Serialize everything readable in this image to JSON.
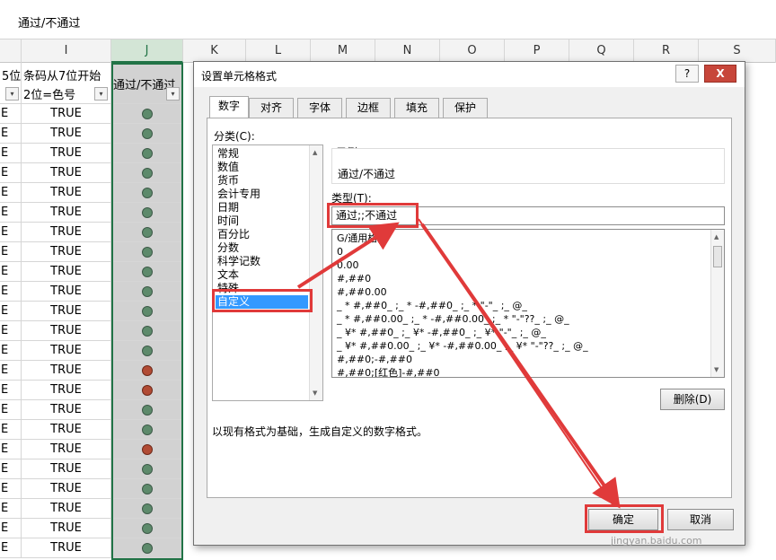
{
  "formula_bar": {
    "value": "通过/不通过"
  },
  "columns": [
    "I",
    "J",
    "K",
    "L",
    "M",
    "N",
    "O",
    "P",
    "Q",
    "R",
    "S"
  ],
  "sheet": {
    "col_h_header": "5位",
    "col_i_header_line1": "条码从7位开始",
    "col_i_header_line2": "2位=色号",
    "col_j_header": "通过/不通过",
    "dropdown_icon": "▾",
    "partial_h_value": "E",
    "rows": [
      {
        "i": "TRUE",
        "dot": "green"
      },
      {
        "i": "TRUE",
        "dot": "green"
      },
      {
        "i": "TRUE",
        "dot": "green"
      },
      {
        "i": "TRUE",
        "dot": "green"
      },
      {
        "i": "TRUE",
        "dot": "green"
      },
      {
        "i": "TRUE",
        "dot": "green"
      },
      {
        "i": "TRUE",
        "dot": "green"
      },
      {
        "i": "TRUE",
        "dot": "green"
      },
      {
        "i": "TRUE",
        "dot": "green"
      },
      {
        "i": "TRUE",
        "dot": "green"
      },
      {
        "i": "TRUE",
        "dot": "green"
      },
      {
        "i": "TRUE",
        "dot": "green"
      },
      {
        "i": "TRUE",
        "dot": "green"
      },
      {
        "i": "TRUE",
        "dot": "red"
      },
      {
        "i": "TRUE",
        "dot": "red"
      },
      {
        "i": "TRUE",
        "dot": "green"
      },
      {
        "i": "TRUE",
        "dot": "green"
      },
      {
        "i": "TRUE",
        "dot": "red"
      },
      {
        "i": "TRUE",
        "dot": "green"
      },
      {
        "i": "TRUE",
        "dot": "green"
      },
      {
        "i": "TRUE",
        "dot": "green"
      },
      {
        "i": "TRUE",
        "dot": "green"
      },
      {
        "i": "TRUE",
        "dot": "green"
      }
    ]
  },
  "dialog": {
    "title": "设置单元格格式",
    "help_label": "?",
    "close_label": "X",
    "tabs": [
      "数字",
      "对齐",
      "字体",
      "边框",
      "填充",
      "保护"
    ],
    "active_tab": "数字",
    "category_label": "分类(C):",
    "categories": [
      "常规",
      "数值",
      "货币",
      "会计专用",
      "日期",
      "时间",
      "百分比",
      "分数",
      "科学记数",
      "文本",
      "特殊",
      "自定义"
    ],
    "selected_category": "自定义",
    "sample_label": "示例",
    "sample_value": "通过/不通过",
    "type_label": "类型(T):",
    "type_value": "通过;;不通过",
    "format_list": [
      "G/通用格式",
      "0",
      "0.00",
      "#,##0",
      "#,##0.00",
      "_ * #,##0_ ;_ * -#,##0_ ;_ * \"-\"_ ;_ @_",
      "_ * #,##0.00_ ;_ * -#,##0.00_ ;_ * \"-\"??_ ;_ @_",
      "_ ¥* #,##0_ ;_ ¥* -#,##0_ ;_ ¥* \"-\"_ ;_ @_",
      "_ ¥* #,##0.00_ ;_ ¥* -#,##0.00_ ;_ ¥* \"-\"??_ ;_ @_",
      "#,##0;-#,##0",
      "#,##0;[红色]-#,##0"
    ],
    "delete_label": "删除(D)",
    "description": "以现有格式为基础，生成自定义的数字格式。",
    "ok_label": "确定",
    "cancel_label": "取消"
  },
  "watermark": "jingyan.baidu.com",
  "colors": {
    "annotation_red": "#e03a3a",
    "selection_green": "#217346",
    "dot_green": "#5d8a6b",
    "dot_red": "#b14b34"
  }
}
